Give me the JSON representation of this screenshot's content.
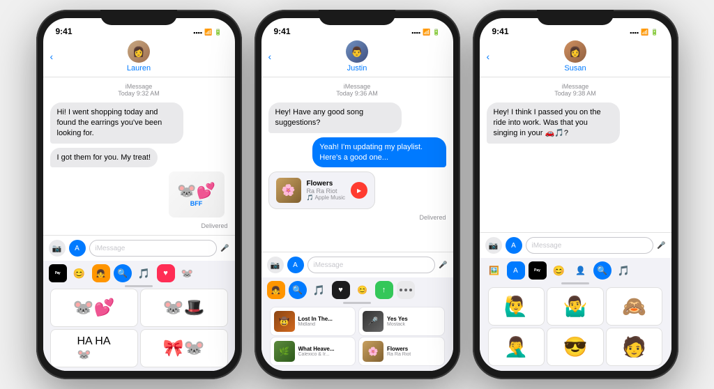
{
  "phones": [
    {
      "id": "phone-1",
      "time": "9:41",
      "contact": "Lauren",
      "avatar_type": "avatar-1",
      "avatar_emoji": "👩",
      "messages": [
        {
          "type": "imessage-label",
          "text": "iMessage\nToday 9:32 AM"
        },
        {
          "type": "incoming",
          "text": "Hi! I went shopping today and found the earrings you've been looking for."
        },
        {
          "type": "incoming",
          "text": "I got them for you. My treat!"
        },
        {
          "type": "sticker",
          "text": "BFF"
        },
        {
          "type": "delivered",
          "text": "Delivered"
        }
      ],
      "tray_icons": [
        "💳",
        "🎯",
        "👧",
        "🔵",
        "🎵",
        "❤️",
        "🐭"
      ],
      "stickers": [
        "🐭💕",
        "🐭🎩",
        "🐭",
        "🎀"
      ],
      "input_placeholder": "iMessage"
    },
    {
      "id": "phone-2",
      "time": "9:41",
      "contact": "Justin",
      "avatar_type": "avatar-2",
      "avatar_emoji": "👨",
      "messages": [
        {
          "type": "imessage-label",
          "text": "iMessage\nToday 9:36 AM"
        },
        {
          "type": "incoming",
          "text": "Hey! Have any good song suggestions?"
        },
        {
          "type": "outgoing",
          "text": "Yeah! I'm updating my playlist. Here's a good one..."
        },
        {
          "type": "music",
          "title": "Flowers",
          "artist": "Ra Ra Riot",
          "source": "Apple Music"
        },
        {
          "type": "delivered",
          "text": "Delivered"
        }
      ],
      "tray_icons": [
        "👧",
        "🔵",
        "🎵",
        "⚫",
        "🎯",
        "💚",
        "···"
      ],
      "music_list": [
        {
          "title": "Lost In The...",
          "artist": "Midland",
          "thumb": "🤠"
        },
        {
          "title": "Yes Yes",
          "artist": "Mostack",
          "thumb": "🎤"
        },
        {
          "title": "What Heave...",
          "artist": "Calexico & Ir...",
          "thumb": "🎸"
        },
        {
          "title": "Flowers",
          "artist": "Ra Ra Riot",
          "thumb": "🌸"
        }
      ],
      "input_placeholder": "iMessage"
    },
    {
      "id": "phone-3",
      "time": "9:41",
      "contact": "Susan",
      "avatar_type": "avatar-3",
      "avatar_emoji": "👩‍🦳",
      "messages": [
        {
          "type": "imessage-label",
          "text": "iMessage\nToday 9:38 AM"
        },
        {
          "type": "incoming",
          "text": "Hey! I think I passed you on the ride into work. Was that you singing in your 🚗🎵?"
        }
      ],
      "tray_icons": [
        "🖼️",
        "📱",
        "💳",
        "😊",
        "👤",
        "🔵",
        "🎵"
      ],
      "memojis": [
        "🙋‍♂️",
        "🤷‍♂️",
        "🙈",
        "🤦‍♂️",
        "😎",
        "🧑"
      ],
      "input_placeholder": "iMessage"
    }
  ],
  "music_card": {
    "title": "Flowers",
    "artist": "Ra Ra Riot",
    "source": "Apple Music"
  }
}
